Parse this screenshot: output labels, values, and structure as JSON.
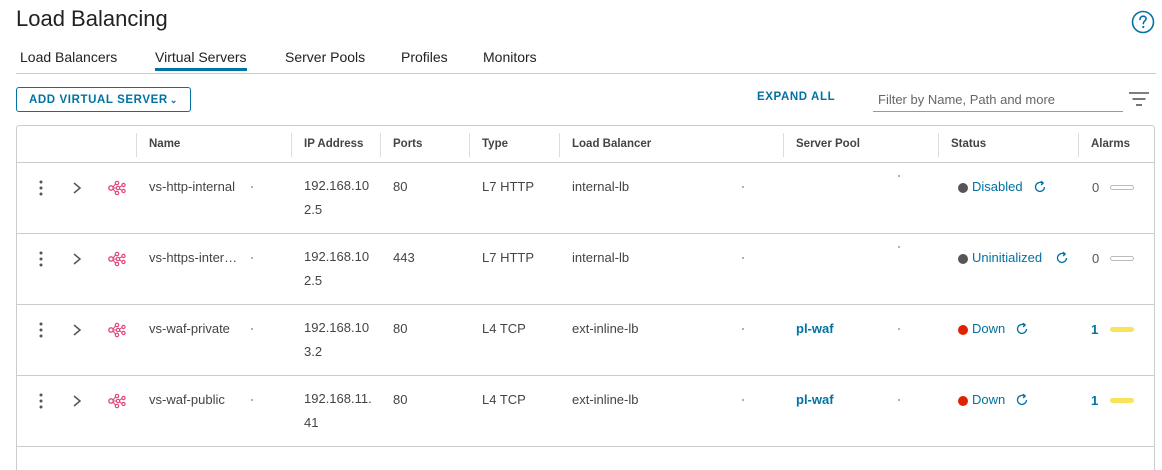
{
  "page": {
    "title": "Load Balancing"
  },
  "tabs": [
    {
      "label": "Load Balancers",
      "active": false
    },
    {
      "label": "Virtual Servers",
      "active": true
    },
    {
      "label": "Server Pools",
      "active": false
    },
    {
      "label": "Profiles",
      "active": false
    },
    {
      "label": "Monitors",
      "active": false
    }
  ],
  "toolbar": {
    "add_label": "ADD VIRTUAL SERVER",
    "expand_all_label": "EXPAND ALL",
    "filter_placeholder": "Filter by Name, Path and more"
  },
  "table": {
    "columns": [
      "Name",
      "IP Address",
      "Ports",
      "Type",
      "Load Balancer",
      "Server Pool",
      "Status",
      "Alarms"
    ],
    "rows": [
      {
        "name": "vs-http-internal",
        "ip_line1": "192.168.10",
        "ip_line2": "2.5",
        "ports": "80",
        "type": "L7 HTTP",
        "load_balancer": "internal-lb",
        "server_pool": "",
        "status": "Disabled",
        "status_color": "#565656",
        "alarms": "0"
      },
      {
        "name": "vs-https-inter…",
        "ip_line1": "192.168.10",
        "ip_line2": "2.5",
        "ports": "443",
        "type": "L7 HTTP",
        "load_balancer": "internal-lb",
        "server_pool": "",
        "status": "Uninitialized",
        "status_color": "#565656",
        "alarms": "0"
      },
      {
        "name": "vs-waf-private",
        "ip_line1": "192.168.10",
        "ip_line2": "3.2",
        "ports": "80",
        "type": "L4 TCP",
        "load_balancer": "ext-inline-lb",
        "server_pool": "pl-waf",
        "status": "Down",
        "status_color": "#e12200",
        "alarms": "1"
      },
      {
        "name": "vs-waf-public",
        "ip_line1": "192.168.11.",
        "ip_line2": "41",
        "ports": "80",
        "type": "L4 TCP",
        "load_balancer": "ext-inline-lb",
        "server_pool": "pl-waf",
        "status": "Down",
        "status_color": "#e12200",
        "alarms": "1"
      }
    ]
  },
  "colors": {
    "accent": "#0072a3",
    "alarm_warning": "#f8e45c",
    "status_down": "#e12200",
    "status_neutral": "#565656",
    "vs_icon": "#e0457b"
  },
  "icons": [
    "help-icon",
    "chevron-down-icon",
    "filter-icon",
    "kebab-icon",
    "chevron-right-icon",
    "virtual-server-icon",
    "refresh-icon"
  ]
}
